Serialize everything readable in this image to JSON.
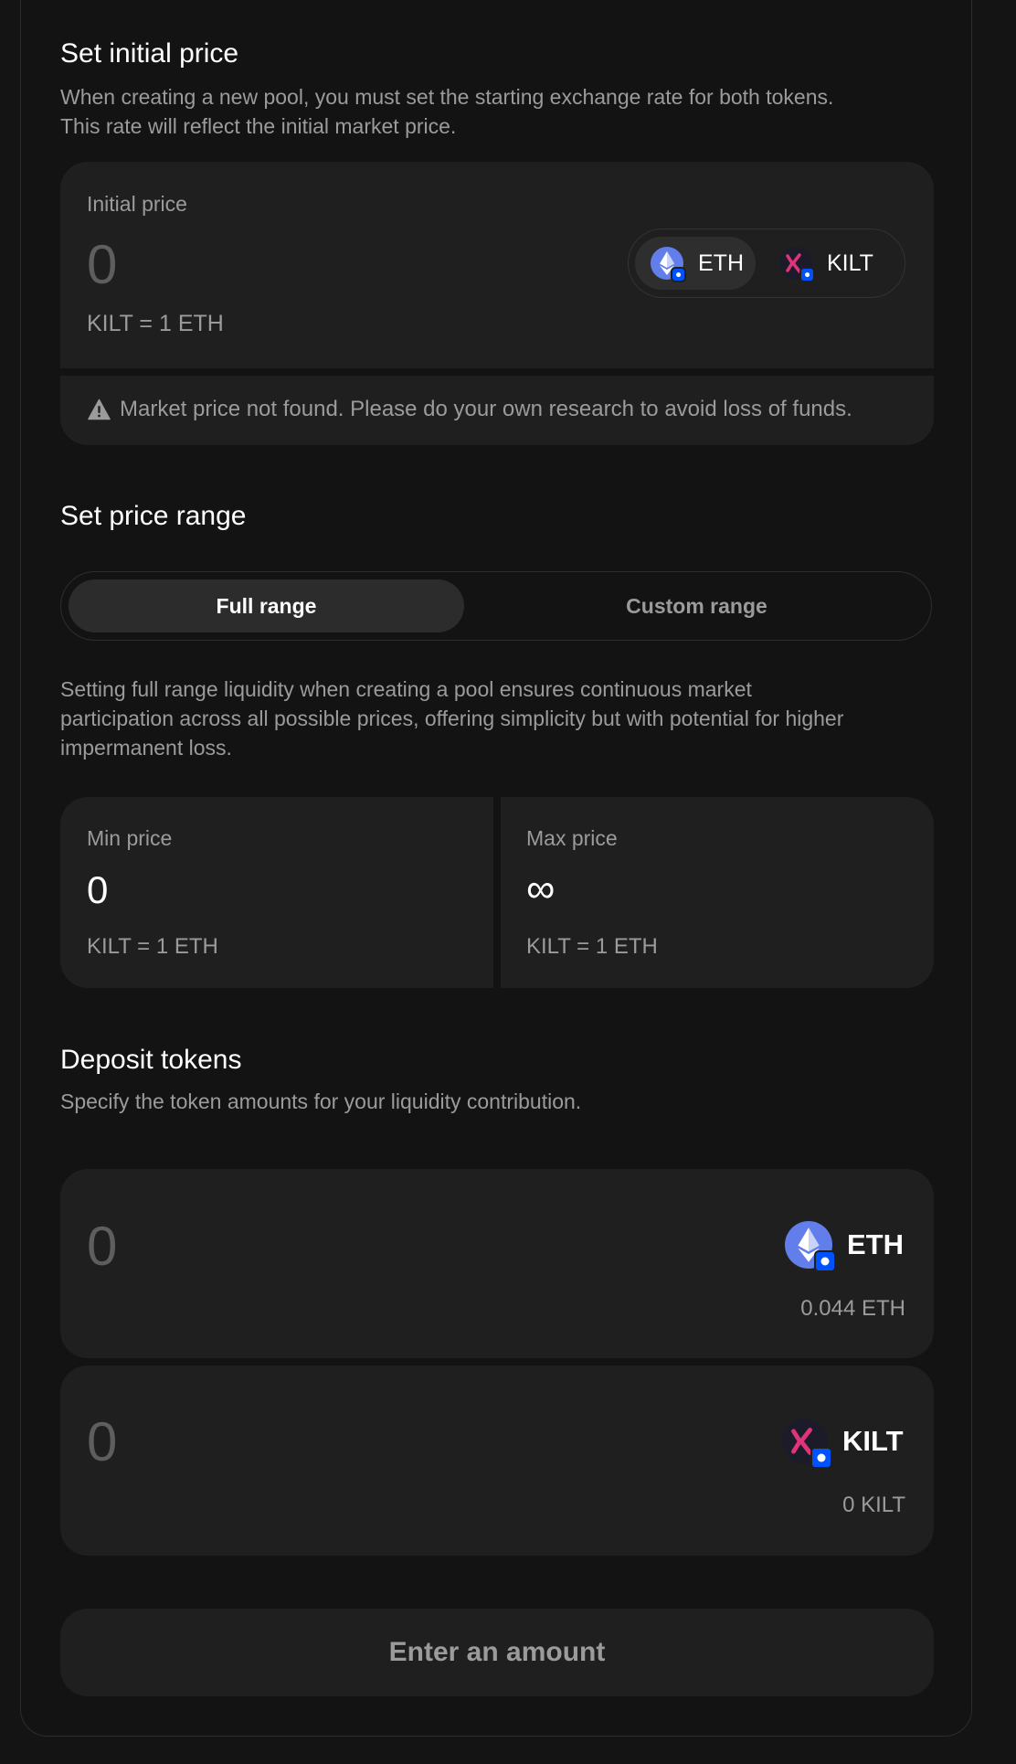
{
  "initial_price": {
    "heading": "Set initial price",
    "description_line1": "When creating a new pool, you must set the starting exchange rate for both tokens.",
    "description_line2": "This rate will reflect the initial market price.",
    "label": "Initial price",
    "value": "0",
    "rate": "KILT = 1 ETH",
    "tokens": [
      {
        "symbol": "ETH",
        "icon": "eth-icon",
        "active": true
      },
      {
        "symbol": "KILT",
        "icon": "kilt-icon",
        "active": false
      }
    ],
    "warning_icon": "warning-icon",
    "warning": "Market price not found. Please do your own research to avoid loss of funds."
  },
  "price_range": {
    "heading": "Set price range",
    "options": [
      {
        "label": "Full range",
        "active": true
      },
      {
        "label": "Custom range",
        "active": false
      }
    ],
    "description_line1": "Setting full range liquidity when creating a pool ensures continuous market",
    "description_line2": "participation across all possible prices, offering simplicity but with potential for higher",
    "description_line3": "impermanent loss.",
    "min": {
      "label": "Min price",
      "value": "0",
      "rate": "KILT = 1 ETH"
    },
    "max": {
      "label": "Max price",
      "value": "∞",
      "rate": "KILT = 1 ETH"
    }
  },
  "deposit": {
    "heading": "Deposit tokens",
    "description": "Specify the token amounts for your liquidity contribution.",
    "rows": [
      {
        "amount": "0",
        "symbol": "ETH",
        "icon": "eth-icon",
        "balance": "0.044 ETH"
      },
      {
        "amount": "0",
        "symbol": "KILT",
        "icon": "kilt-icon",
        "balance": "0 KILT"
      }
    ]
  },
  "submit_label": "Enter an amount",
  "colors": {
    "background": "#141414",
    "panel": "#1f1f1f",
    "eth": "#627eea",
    "kilt_accent": "#e0347a",
    "chain_badge": "#0052ff"
  }
}
